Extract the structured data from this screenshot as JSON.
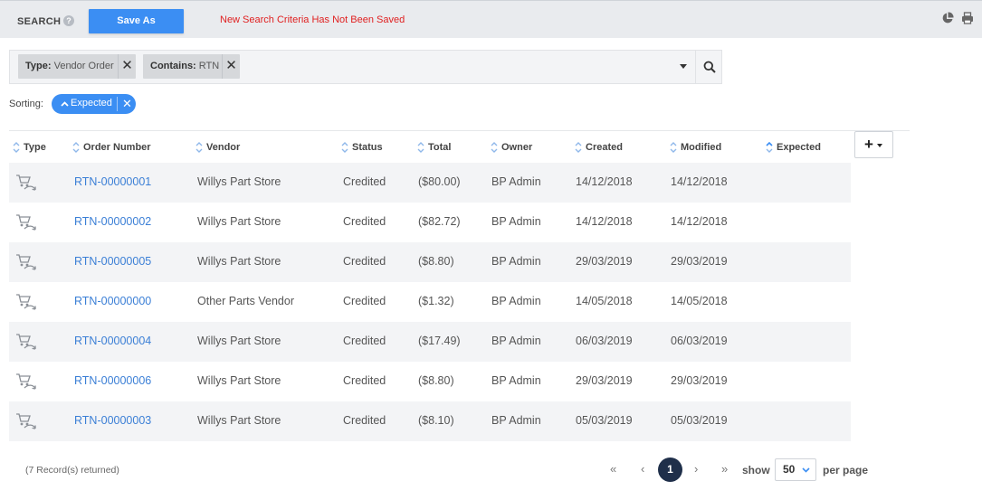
{
  "header": {
    "title": "SEARCH",
    "help_glyph": "?",
    "save_as_label": "Save As",
    "unsaved_message": "New Search Criteria Has Not Been Saved",
    "icons": [
      "pie-chart-icon",
      "print-icon"
    ]
  },
  "filters": {
    "chips": [
      {
        "key": "Type:",
        "value": "Vendor Order"
      },
      {
        "key": "Contains:",
        "value": "RTN"
      }
    ],
    "remove_glyph": "✕"
  },
  "sorting": {
    "label": "Sorting:",
    "active": "Expected",
    "remove_glyph": "✕"
  },
  "table": {
    "columns": [
      "Type",
      "Order Number",
      "Vendor",
      "Status",
      "Total",
      "Owner",
      "Created",
      "Modified",
      "Expected"
    ],
    "column_menu_label": "+",
    "rows": [
      {
        "order": "RTN-00000001",
        "vendor": "Willys Part Store",
        "status": "Credited",
        "total": "($80.00)",
        "owner": "BP Admin",
        "created": "14/12/2018",
        "modified": "14/12/2018",
        "expected": ""
      },
      {
        "order": "RTN-00000002",
        "vendor": "Willys Part Store",
        "status": "Credited",
        "total": "($82.72)",
        "owner": "BP Admin",
        "created": "14/12/2018",
        "modified": "14/12/2018",
        "expected": ""
      },
      {
        "order": "RTN-00000005",
        "vendor": "Willys Part Store",
        "status": "Credited",
        "total": "($8.80)",
        "owner": "BP Admin",
        "created": "29/03/2019",
        "modified": "29/03/2019",
        "expected": ""
      },
      {
        "order": "RTN-00000000",
        "vendor": "Other Parts Vendor",
        "status": "Credited",
        "total": "($1.32)",
        "owner": "BP Admin",
        "created": "14/05/2018",
        "modified": "14/05/2018",
        "expected": ""
      },
      {
        "order": "RTN-00000004",
        "vendor": "Willys Part Store",
        "status": "Credited",
        "total": "($17.49)",
        "owner": "BP Admin",
        "created": "06/03/2019",
        "modified": "06/03/2019",
        "expected": ""
      },
      {
        "order": "RTN-00000006",
        "vendor": "Willys Part Store",
        "status": "Credited",
        "total": "($8.80)",
        "owner": "BP Admin",
        "created": "29/03/2019",
        "modified": "29/03/2019",
        "expected": ""
      },
      {
        "order": "RTN-00000003",
        "vendor": "Willys Part Store",
        "status": "Credited",
        "total": "($8.10)",
        "owner": "BP Admin",
        "created": "05/03/2019",
        "modified": "05/03/2019",
        "expected": ""
      }
    ]
  },
  "footer": {
    "records_text": "(7 Record(s) returned)",
    "first_glyph": "«",
    "prev_glyph": "‹",
    "current_page": "1",
    "next_glyph": "›",
    "last_glyph": "»",
    "show_label": "show",
    "per_page_value": "50",
    "per_page_label": "per page"
  },
  "colors": {
    "accent": "#3b8ef3",
    "link": "#3b7fd6",
    "warning": "#e02020",
    "pager_active": "#1f2f4a"
  }
}
